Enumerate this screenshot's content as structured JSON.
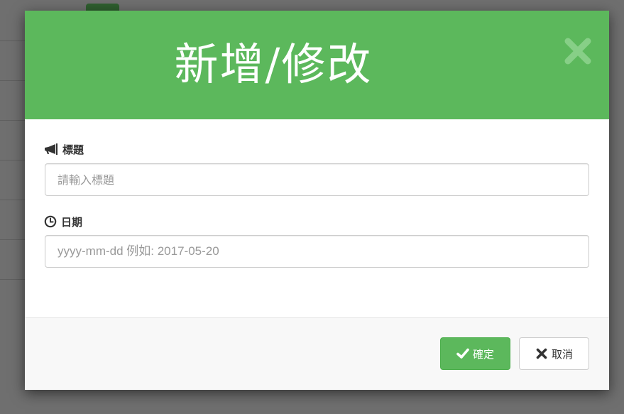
{
  "modal": {
    "title": "新增/修改",
    "close_icon": "close-icon"
  },
  "form": {
    "title_field": {
      "label": "標題",
      "icon": "bullhorn-icon",
      "value": "",
      "placeholder": "請輸入標題"
    },
    "date_field": {
      "label": "日期",
      "icon": "clock-icon",
      "value": "",
      "placeholder": "yyyy-mm-dd 例如: 2017-05-20"
    }
  },
  "footer": {
    "confirm_label": "確定",
    "confirm_icon": "check-icon",
    "cancel_label": "取消",
    "cancel_icon": "cross-icon"
  },
  "colors": {
    "primary": "#5cb85c",
    "backdrop": "#6f6f6f"
  }
}
